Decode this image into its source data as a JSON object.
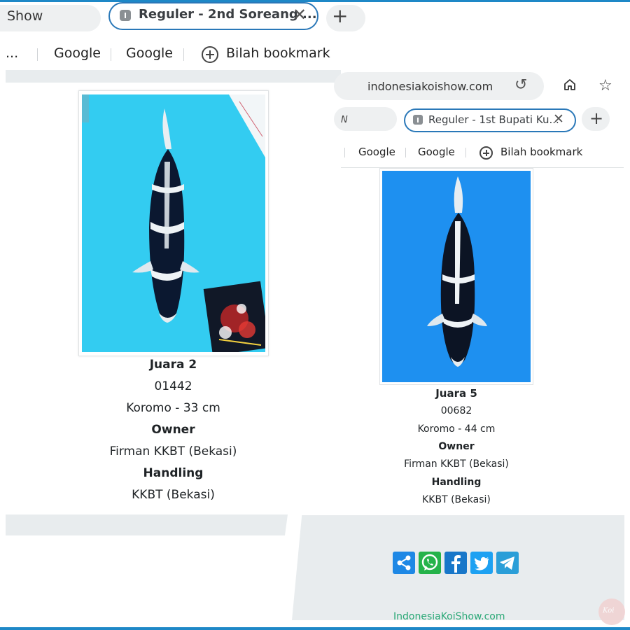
{
  "left": {
    "browser": {
      "prev_tab_label": "Show",
      "active_tab_label": "Reguler - 2nd Soreang ...",
      "close_glyph": "✕",
      "new_tab_glyph": "+",
      "bookmarks": [
        "...",
        "Google",
        "Google",
        "Bilah bookmark"
      ]
    },
    "entry": {
      "rank": "Juara 2",
      "code": "01442",
      "variety_size": "Koromo - 33 cm",
      "owner_label": "Owner",
      "owner": "Firman KKBT (Bekasi)",
      "handling_label": "Handling",
      "handling": "KKBT (Bekasi)"
    },
    "photo_bg": "#2fc8ee"
  },
  "right": {
    "browser": {
      "url": "indonesiakoishow.com",
      "prev_tab_label": "N",
      "active_tab_label": "Reguler - 1st Bupati Ku...",
      "close_glyph": "✕",
      "new_tab_glyph": "+",
      "bookmarks": [
        "Google",
        "Google",
        "Bilah bookmark"
      ]
    },
    "entry": {
      "rank": "Juara 5",
      "code": "00682",
      "variety_size": "Koromo - 44 cm",
      "owner_label": "Owner",
      "owner": "Firman KKBT (Bekasi)",
      "handling_label": "Handling",
      "handling": "KKBT (Bekasi)"
    },
    "photo_bg": "#1e90f0",
    "share_buttons": [
      {
        "icon": "share-icon",
        "color": "#1e88e5"
      },
      {
        "icon": "whatsapp-icon",
        "color": "#25b34a"
      },
      {
        "icon": "facebook-icon",
        "color": "#1877c9"
      },
      {
        "icon": "twitter-icon",
        "color": "#1da1f2"
      },
      {
        "icon": "telegram-icon",
        "color": "#2a9ed8"
      }
    ],
    "site_footer": "IndonesiaKoiShow.com"
  },
  "frame_color": "#1e88c7"
}
